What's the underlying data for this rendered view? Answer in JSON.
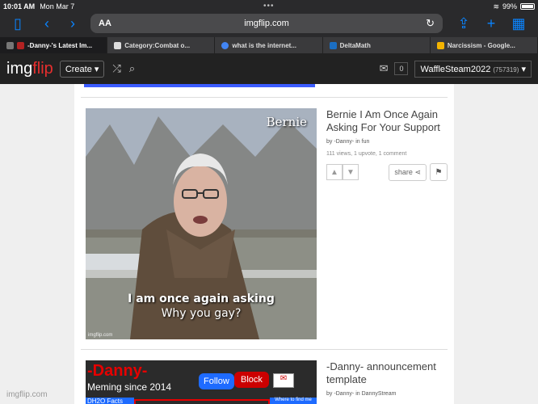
{
  "status": {
    "time": "10:01 AM",
    "date": "Mon Mar 7",
    "battery": "99%"
  },
  "safari": {
    "aa": "AA",
    "url": "imgflip.com",
    "reload": "↻"
  },
  "tabs": [
    {
      "label": "-Danny-'s Latest Im...",
      "color": "#b22222",
      "active": true
    },
    {
      "label": "Category:Combat o...",
      "color": "#777"
    },
    {
      "label": "what is the internet...",
      "color": "#4285f4"
    },
    {
      "label": "DeltaMath",
      "color": "#1b6ec2"
    },
    {
      "label": "Narcissism - Google...",
      "color": "#f4b400"
    }
  ],
  "imgflip": {
    "logo_main": "img",
    "logo_accent": "flip",
    "create": "Create",
    "notif_count": "0",
    "username": "WaffleSteam2022",
    "points": "(757319)"
  },
  "posts": [
    {
      "title": "Bernie I Am Once Again Asking For Your Support",
      "by_prefix": "by",
      "author": "-Danny-",
      "in": "in",
      "stream": "fun",
      "stats": "111 views, 1 upvote, 1 comment",
      "share": "share",
      "caption_top": "Bernie",
      "caption_bold": "I am once again asking",
      "caption_line2": "Why you gay?",
      "watermark": "imgflip.com"
    },
    {
      "title": "-Danny- announcement template",
      "by_prefix": "by",
      "author": "-Danny-",
      "in": "in",
      "stream": "DannyStream",
      "meme_name": "-Danny-",
      "meme_tagline": "Meming since 2014",
      "follow": "Follow",
      "block": "Block",
      "facts": "DH2O Facts",
      "where": "Where to find me"
    }
  ],
  "footer_watermark": "imgflip.com"
}
